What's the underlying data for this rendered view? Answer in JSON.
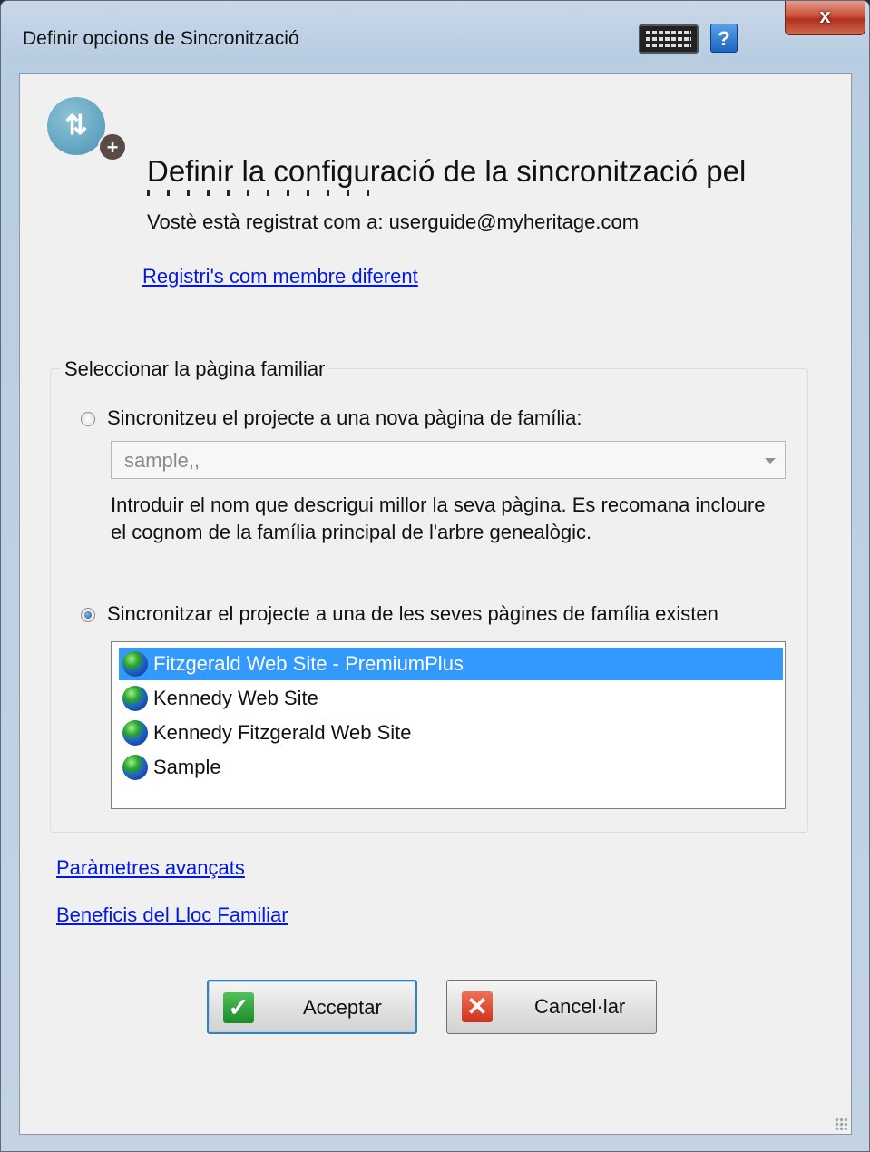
{
  "window": {
    "title": "Definir opcions de Sincronització",
    "close_label": "x",
    "help_label": "?"
  },
  "header": {
    "heading": "Definir la configuració de la sincronització pel",
    "user_info": "Vostè està registrat com a: userguide@myheritage.com",
    "switch_user_link": "Registri's com membre diferent"
  },
  "family_site": {
    "group_label": "Seleccionar la pàgina familiar",
    "option_new": {
      "label": "Sincronitzeu el projecte a una nova pàgina de família:",
      "selected": false,
      "name_value": "sample,,",
      "hint": "Introduir el nom que descrigui millor la seva pàgina. Es recomana incloure el cognom de la família principal de l'arbre genealògic."
    },
    "option_existing": {
      "label": "Sincronitzar el projecte a una de les seves pàgines de família existen",
      "selected": true,
      "sites": [
        {
          "name": "Fitzgerald Web Site - PremiumPlus",
          "icon": "globe-icon",
          "selected": true
        },
        {
          "name": "Kennedy Web Site",
          "icon": "globe-icon",
          "selected": false
        },
        {
          "name": "Kennedy Fitzgerald Web Site",
          "icon": "globe-icon",
          "selected": false
        },
        {
          "name": "Sample",
          "icon": "globe-icon",
          "selected": false
        }
      ]
    }
  },
  "links": {
    "advanced": "Paràmetres avançats",
    "benefits": "Beneficis del Lloc Familiar"
  },
  "buttons": {
    "ok_label": "Acceptar",
    "cancel_label": "Cancel·lar"
  },
  "colors": {
    "link": "#0018e6",
    "selection": "#3399ff",
    "ok_icon": "#2e9e3a",
    "cancel_icon": "#e0402a"
  }
}
